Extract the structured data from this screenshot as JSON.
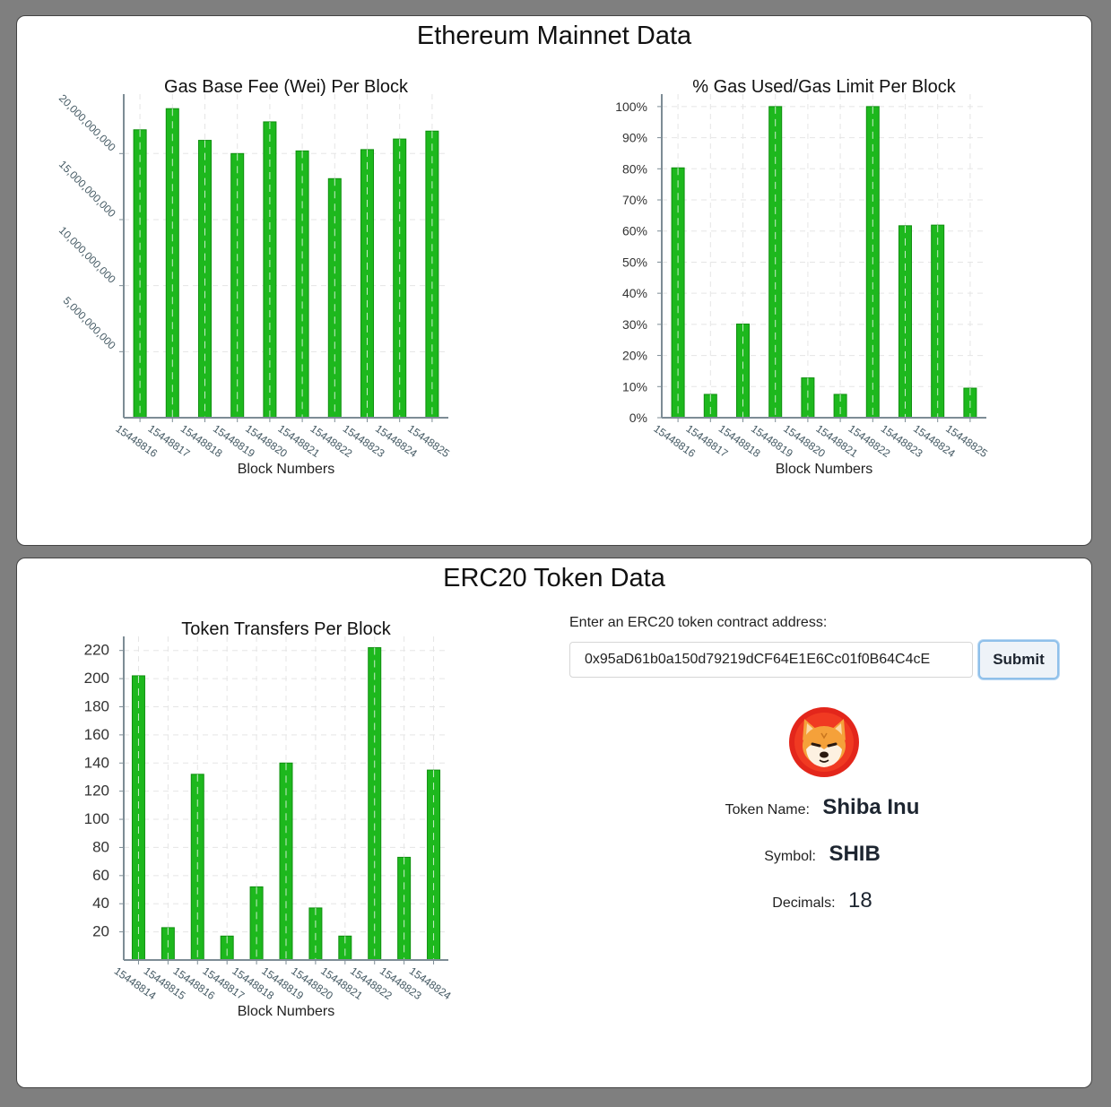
{
  "eth_section": {
    "title": "Ethereum Mainnet Data"
  },
  "erc_section": {
    "title": "ERC20 Token Data",
    "form": {
      "label": "Enter an ERC20 token contract address:",
      "address_value": "0x95aD61b0a150d79219dCF64E1E6Cc01f0B64C4cE",
      "submit_label": "Submit"
    },
    "token": {
      "logo_icon": "shiba-inu-logo-icon",
      "name_label": "Token Name:",
      "name_value": "Shiba Inu",
      "symbol_label": "Symbol:",
      "symbol_value": "SHIB",
      "decimals_label": "Decimals:",
      "decimals_value": "18"
    }
  },
  "colors": {
    "bar": "#1db81d",
    "bar_edge": "#0f8f0f",
    "axis": "#7d8c95",
    "grid": "#e5e5e5"
  },
  "chart_data": [
    {
      "id": "gas-base-fee-chart",
      "type": "bar",
      "title": "Gas Base Fee (Wei) Per Block",
      "xlabel": "Block Numbers",
      "ylabel": "",
      "categories": [
        "15448816",
        "15448817",
        "15448818",
        "15448819",
        "15448820",
        "15448821",
        "15448822",
        "15448823",
        "15448824",
        "15448825"
      ],
      "values": [
        21800000000,
        23400000000,
        21000000000,
        20000000000,
        22400000000,
        20200000000,
        18100000000,
        20300000000,
        21100000000,
        21700000000
      ],
      "ylim": [
        0,
        24500000000
      ],
      "yticks": [
        5000000000,
        10000000000,
        15000000000,
        20000000000
      ],
      "ytick_labels": [
        "5,000,000,000",
        "10,000,000,000",
        "15,000,000,000",
        "20,000,000,000"
      ],
      "grid": true
    },
    {
      "id": "gas-used-chart",
      "type": "bar",
      "title": "% Gas Used/Gas Limit Per Block",
      "xlabel": "Block Numbers",
      "ylabel": "",
      "categories": [
        "15448816",
        "15448817",
        "15448818",
        "15448819",
        "15448820",
        "15448821",
        "15448822",
        "15448823",
        "15448824",
        "15448825"
      ],
      "values": [
        80.3,
        7.5,
        30.1,
        100,
        12.8,
        7.5,
        100,
        61.7,
        61.9,
        9.5
      ],
      "ylim": [
        0,
        104
      ],
      "yticks": [
        0,
        10,
        20,
        30,
        40,
        50,
        60,
        70,
        80,
        90,
        100
      ],
      "ytick_labels": [
        "0%",
        "10%",
        "20%",
        "30%",
        "40%",
        "50%",
        "60%",
        "70%",
        "80%",
        "90%",
        "100%"
      ],
      "grid": true
    },
    {
      "id": "token-transfers-chart",
      "type": "bar",
      "title": "Token Transfers Per Block",
      "xlabel": "Block Numbers",
      "ylabel": "",
      "categories": [
        "15448814",
        "15448815",
        "15448816",
        "15448817",
        "15448818",
        "15448819",
        "15448820",
        "15448821",
        "15448822",
        "15448823",
        "15448824"
      ],
      "values": [
        202,
        23,
        132,
        17,
        52,
        140,
        37,
        17,
        222,
        73,
        135
      ],
      "ylim": [
        0,
        230
      ],
      "yticks": [
        20,
        40,
        60,
        80,
        100,
        120,
        140,
        160,
        180,
        200,
        220
      ],
      "ytick_labels": [
        "20",
        "40",
        "60",
        "80",
        "100",
        "120",
        "140",
        "160",
        "180",
        "200",
        "220"
      ],
      "grid": true
    }
  ]
}
